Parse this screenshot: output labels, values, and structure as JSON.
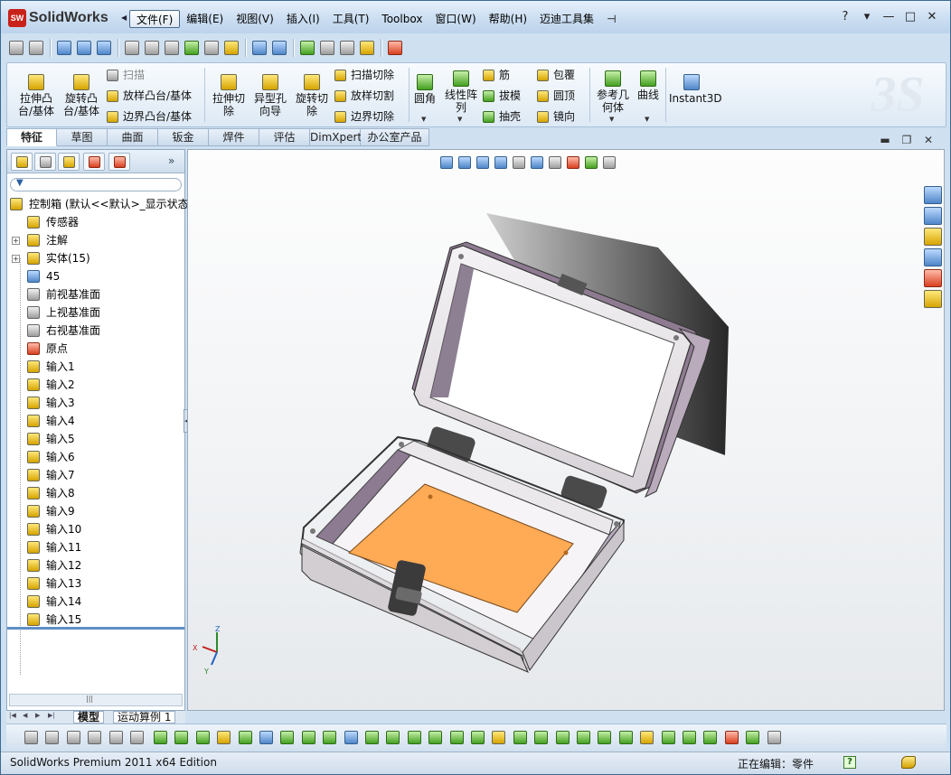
{
  "app": {
    "logo_text": "SW",
    "name": "SolidWorks",
    "menus": [
      "文件(F)",
      "编辑(E)",
      "视图(V)",
      "插入(I)",
      "工具(T)",
      "Toolbox",
      "窗口(W)",
      "帮助(H)",
      "迈迪工具集"
    ],
    "window_controls": [
      "?",
      "▾",
      "—",
      "□",
      "✕"
    ]
  },
  "features_toolbar": {
    "extrude_boss": "拉伸凸\n台/基体",
    "revolve_boss": "旋转凸\n台/基体",
    "sweep": "扫描",
    "loft_boss": "放样凸台/基体",
    "boundary_boss": "边界凸台/基体",
    "extrude_cut": "拉伸切\n除",
    "hole_wizard": "异型孔\n向导",
    "revolve_cut": "旋转切\n除",
    "sweep_cut": "扫描切除",
    "loft_cut": "放样切割",
    "boundary_cut": "边界切除",
    "fillet": "圆角",
    "linear_pattern": "线性阵\n列",
    "rib": "筋",
    "draft": "拔模",
    "shell": "抽壳",
    "wrap": "包覆",
    "dome": "圆顶",
    "mirror": "镜向",
    "ref_geometry": "参考几\n何体",
    "curves": "曲线",
    "instant3d": "Instant3D"
  },
  "tabs": [
    "特征",
    "草图",
    "曲面",
    "钣金",
    "焊件",
    "评估",
    "DimXpert",
    "办公室产品"
  ],
  "active_tab": "特征",
  "feature_tree": {
    "root": "控制箱 (默认<<默认>_显示状态",
    "items": [
      {
        "label": "传感器",
        "icon": "sensor-icon",
        "expandable": false
      },
      {
        "label": "注解",
        "icon": "annotation-icon",
        "expandable": true
      },
      {
        "label": "实体(15)",
        "icon": "solid-bodies-icon",
        "expandable": true
      },
      {
        "label": "45",
        "icon": "material-icon",
        "expandable": false
      },
      {
        "label": "前视基准面",
        "icon": "plane-icon",
        "expandable": false
      },
      {
        "label": "上视基准面",
        "icon": "plane-icon",
        "expandable": false
      },
      {
        "label": "右视基准面",
        "icon": "plane-icon",
        "expandable": false
      },
      {
        "label": "原点",
        "icon": "origin-icon",
        "expandable": false
      },
      {
        "label": "输入1",
        "icon": "imported-body-icon",
        "expandable": false
      },
      {
        "label": "输入2",
        "icon": "imported-body-icon",
        "expandable": false
      },
      {
        "label": "输入3",
        "icon": "imported-body-icon",
        "expandable": false
      },
      {
        "label": "输入4",
        "icon": "imported-body-icon",
        "expandable": false
      },
      {
        "label": "输入5",
        "icon": "imported-body-icon",
        "expandable": false
      },
      {
        "label": "输入6",
        "icon": "imported-body-icon",
        "expandable": false
      },
      {
        "label": "输入7",
        "icon": "imported-body-icon",
        "expandable": false
      },
      {
        "label": "输入8",
        "icon": "imported-body-icon",
        "expandable": false
      },
      {
        "label": "输入9",
        "icon": "imported-body-icon",
        "expandable": false
      },
      {
        "label": "输入10",
        "icon": "imported-body-icon",
        "expandable": false
      },
      {
        "label": "输入11",
        "icon": "imported-body-icon",
        "expandable": false
      },
      {
        "label": "输入12",
        "icon": "imported-body-icon",
        "expandable": false
      },
      {
        "label": "输入13",
        "icon": "imported-body-icon",
        "expandable": false
      },
      {
        "label": "输入14",
        "icon": "imported-body-icon",
        "expandable": false
      },
      {
        "label": "输入15",
        "icon": "imported-body-icon",
        "expandable": false
      }
    ]
  },
  "model_tabs": [
    "模型",
    "运动算例 1"
  ],
  "triad": {
    "x": "X",
    "y": "Y",
    "z": "Z"
  },
  "status": {
    "product": "SolidWorks Premium 2011 x64 Edition",
    "editing": "正在编辑：零件",
    "help": "?"
  },
  "colors": {
    "accent": "#3b6a92",
    "lid_frame": "#e8e6ea",
    "box_wall": "#cfcccf",
    "inner_wall": "#8a7a8e",
    "pcb": "#ffaa55"
  }
}
